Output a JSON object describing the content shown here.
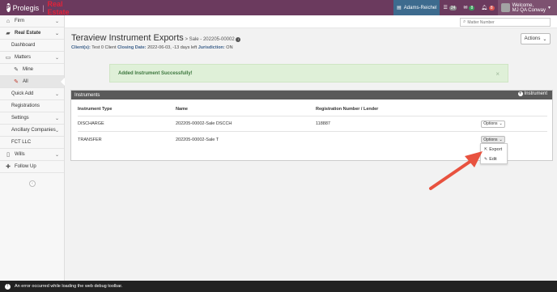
{
  "header": {
    "brand_name": "Prolegis",
    "brand_product": "Real Estate",
    "office": "Adams-Reichel",
    "badges": [
      "24",
      "8",
      "8"
    ],
    "welcome_line1": "Welcome,",
    "welcome_line2": "MJ QA Conway",
    "colors": {
      "bar": "#6b3a5e",
      "office": "#3d6b8e",
      "accent_red": "#e0233a"
    }
  },
  "search": {
    "placeholder": "Matter Number"
  },
  "sidebar": {
    "items": [
      {
        "label": "Firm",
        "icon": "building-icon"
      },
      {
        "label": "Real Estate",
        "icon": "home-icon"
      },
      {
        "label": "Dashboard"
      },
      {
        "label": "Matters",
        "icon": "folder-icon"
      },
      {
        "label": "Mine",
        "icon": "pencil-icon"
      },
      {
        "label": "All",
        "icon": "pencil-icon"
      },
      {
        "label": "Quick Add"
      },
      {
        "label": "Registrations"
      },
      {
        "label": "Settings"
      },
      {
        "label": "Ancillary Companies"
      },
      {
        "label": "FCT LLC"
      },
      {
        "label": "Wills",
        "icon": "document-icon"
      },
      {
        "label": "Follow Up",
        "icon": "plus-icon"
      }
    ]
  },
  "page": {
    "title": "Teraview Instrument Exports",
    "subtitle": "> Sale - 202205-00002",
    "clients_label": "Client(s):",
    "clients_value": "Test 0 Client",
    "closing_label": "Closing Date:",
    "closing_value": "2022-06-03, -13 days left",
    "jurisdiction_label": "Jurisdiction:",
    "jurisdiction_value": "ON",
    "actions_label": "Actions"
  },
  "alert": {
    "text": "Added Instrument Successfully!",
    "close": "×"
  },
  "panel": {
    "title": "Instruments",
    "add_label": "Instrument",
    "columns": [
      "Instrument Type",
      "Name",
      "Registration Number / Lender"
    ],
    "rows": [
      {
        "type": "DISCHARGE",
        "name": "202205-00002-Sale DSCCH",
        "reg": "118887",
        "options": "Options"
      },
      {
        "type": "TRANSFER",
        "name": "202205-00002-Sale T",
        "reg": "",
        "options": "Options"
      }
    ]
  },
  "dropdown": {
    "items": [
      {
        "label": "Export",
        "icon": "export-icon"
      },
      {
        "label": "Edit",
        "icon": "pencil-icon"
      }
    ]
  },
  "footer": {
    "message": "An error occurred while loading the web debug toolbar."
  }
}
